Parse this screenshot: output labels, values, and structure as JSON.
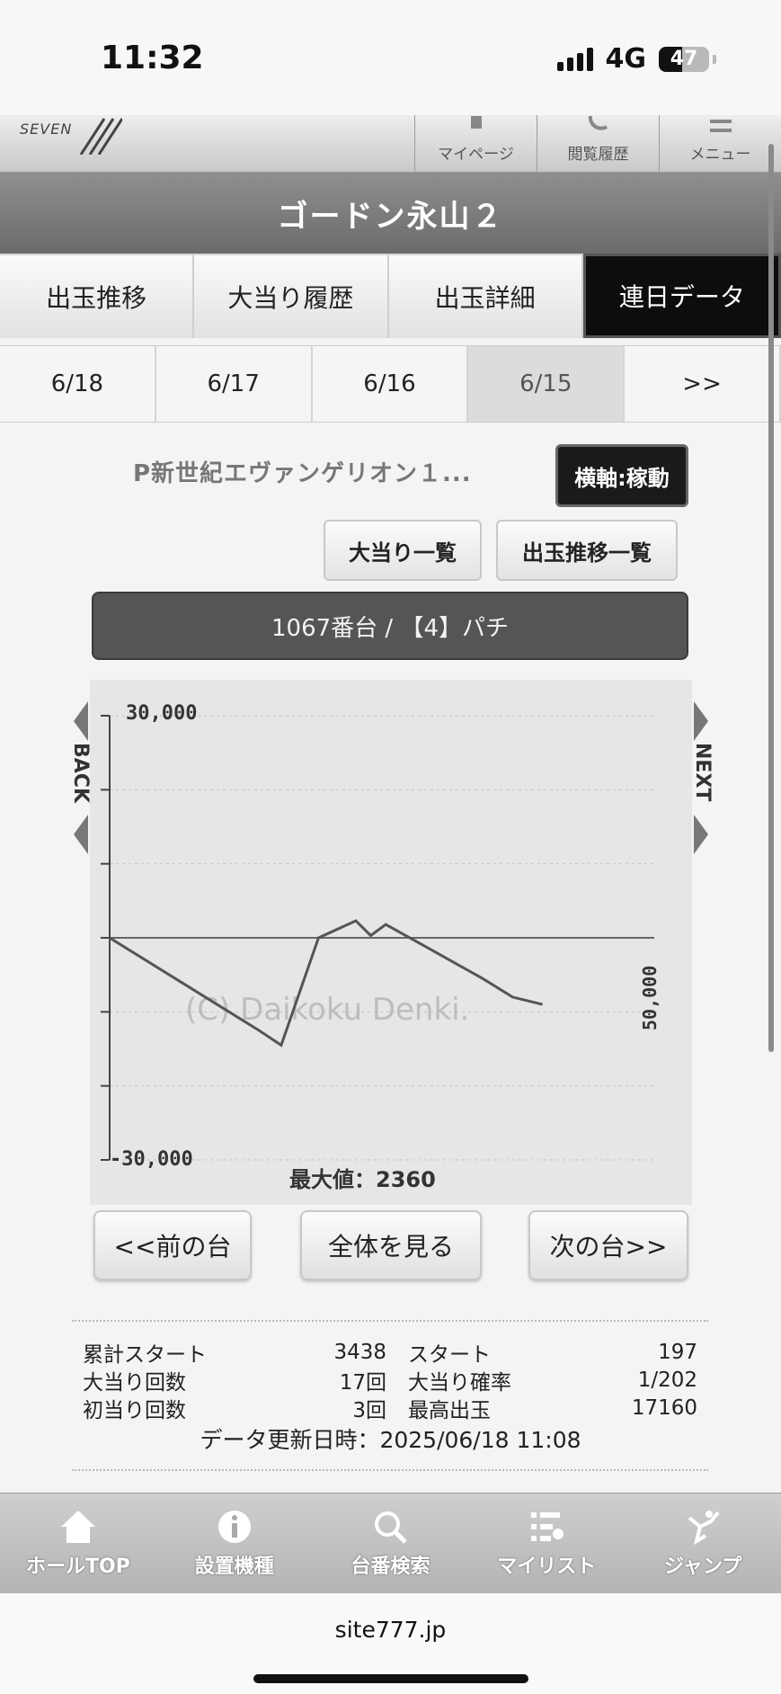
{
  "status": {
    "time": "11:32",
    "network": "4G",
    "battery": "47"
  },
  "header": {
    "logo_text": "SEVEN",
    "mypage": "マイページ",
    "history": "閲覧履歴",
    "menu": "メニュー"
  },
  "hall_title": "ゴードン永山２",
  "tabs": [
    "出玉推移",
    "大当り履歴",
    "出玉詳細",
    "連日データ"
  ],
  "dates": [
    "6/18",
    "6/17",
    "6/16",
    "6/15",
    ">>"
  ],
  "machine_name": "P新世紀エヴァンゲリオン１...",
  "axis_button": "横軸:稼動",
  "buttons": {
    "jackpot_list": "大当り一覧",
    "payout_list": "出玉推移一覧"
  },
  "unit_label": "1067番台 / 【4】パチ",
  "chart_data": {
    "type": "line",
    "ylim": [
      -30000,
      30000
    ],
    "y_tick_labels": [
      "30,000",
      "-30,000"
    ],
    "x_end_label": "50,000",
    "watermark": "(C) Daikoku Denki.",
    "max_label": "最大値：2360",
    "back_label": "BACK",
    "next_label": "NEXT",
    "series": [
      {
        "x": [
          0,
          8000,
          16000,
          20000,
          23000,
          28000,
          33000,
          35000,
          37000,
          42000,
          50000,
          54000,
          58000
        ],
        "values": [
          0,
          -5000,
          -10000,
          -12500,
          -14500,
          0,
          2300,
          300,
          1800,
          -1000,
          -5500,
          -8000,
          -9000
        ]
      }
    ],
    "x_max": 73000
  },
  "nav": {
    "prev": "<<前の台",
    "all": "全体を見る",
    "next": "次の台>>"
  },
  "stats": [
    {
      "l1": "累計スタート",
      "v1": "3438",
      "l2": "スタート",
      "v2": "197"
    },
    {
      "l1": "大当り回数",
      "v1": "17回",
      "l2": "大当り確率",
      "v2": "1/202"
    },
    {
      "l1": "初当り回数",
      "v1": "3回",
      "l2": "最高出玉",
      "v2": "17160"
    }
  ],
  "update_time": "データ更新日時：2025/06/18 11:08",
  "bottom_nav": [
    "ホールTOP",
    "設置機種",
    "台番検索",
    "マイリスト",
    "ジャンプ"
  ],
  "url": "site777.jp"
}
